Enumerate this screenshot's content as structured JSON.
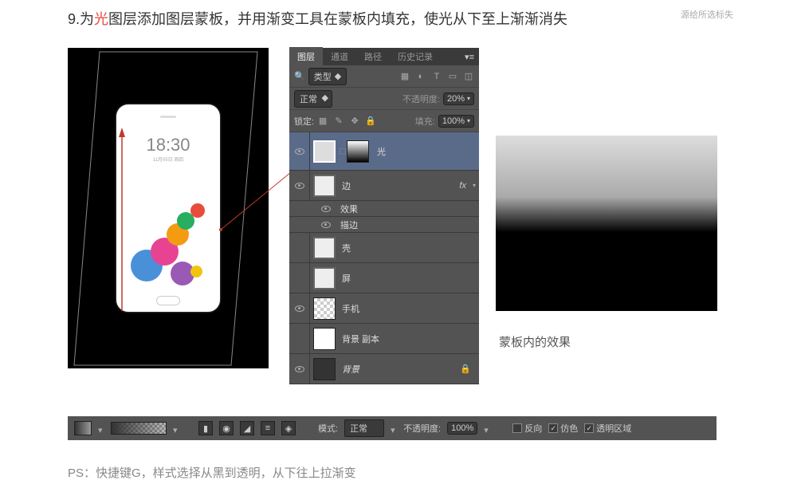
{
  "instruction": {
    "prefix": "9.为",
    "highlight": "光",
    "suffix": "图层添加图层蒙板，并用渐变工具在蒙板内填充，使光从下至上渐渐消失"
  },
  "watermark": "源给所选标失",
  "phone": {
    "time": "18:30",
    "date": "11月05日 周四"
  },
  "panel": {
    "tabs": [
      "图层",
      "通道",
      "路径",
      "历史记录"
    ],
    "kind_label": "类型",
    "blend_mode": "正常",
    "opacity_label": "不透明度:",
    "opacity_value": "20%",
    "lock_label": "锁定:",
    "fill_label": "填充:",
    "fill_value": "100%",
    "layers": [
      {
        "name": "光",
        "selected": true,
        "visible": true,
        "mask": true
      },
      {
        "name": "边",
        "visible": true,
        "fx": "fx"
      },
      {
        "name": "效果",
        "sub": true
      },
      {
        "name": "描边",
        "sub": true
      },
      {
        "name": "壳",
        "visible": false
      },
      {
        "name": "屏",
        "visible": false
      },
      {
        "name": "手机",
        "visible": true,
        "transparent": true
      },
      {
        "name": "背景 副本",
        "visible": false
      },
      {
        "name": "背景",
        "visible": true,
        "locked": true,
        "italic": true,
        "dark": true
      }
    ]
  },
  "gradient_caption": "蒙板内的效果",
  "options": {
    "mode_label": "模式:",
    "mode_value": "正常",
    "opacity_label": "不透明度:",
    "opacity_value": "100%",
    "reverse": "反向",
    "dither": "仿色",
    "transparency": "透明区域"
  },
  "footer": "PS：快捷键G，样式选择从黑到透明，从下往上拉渐变"
}
